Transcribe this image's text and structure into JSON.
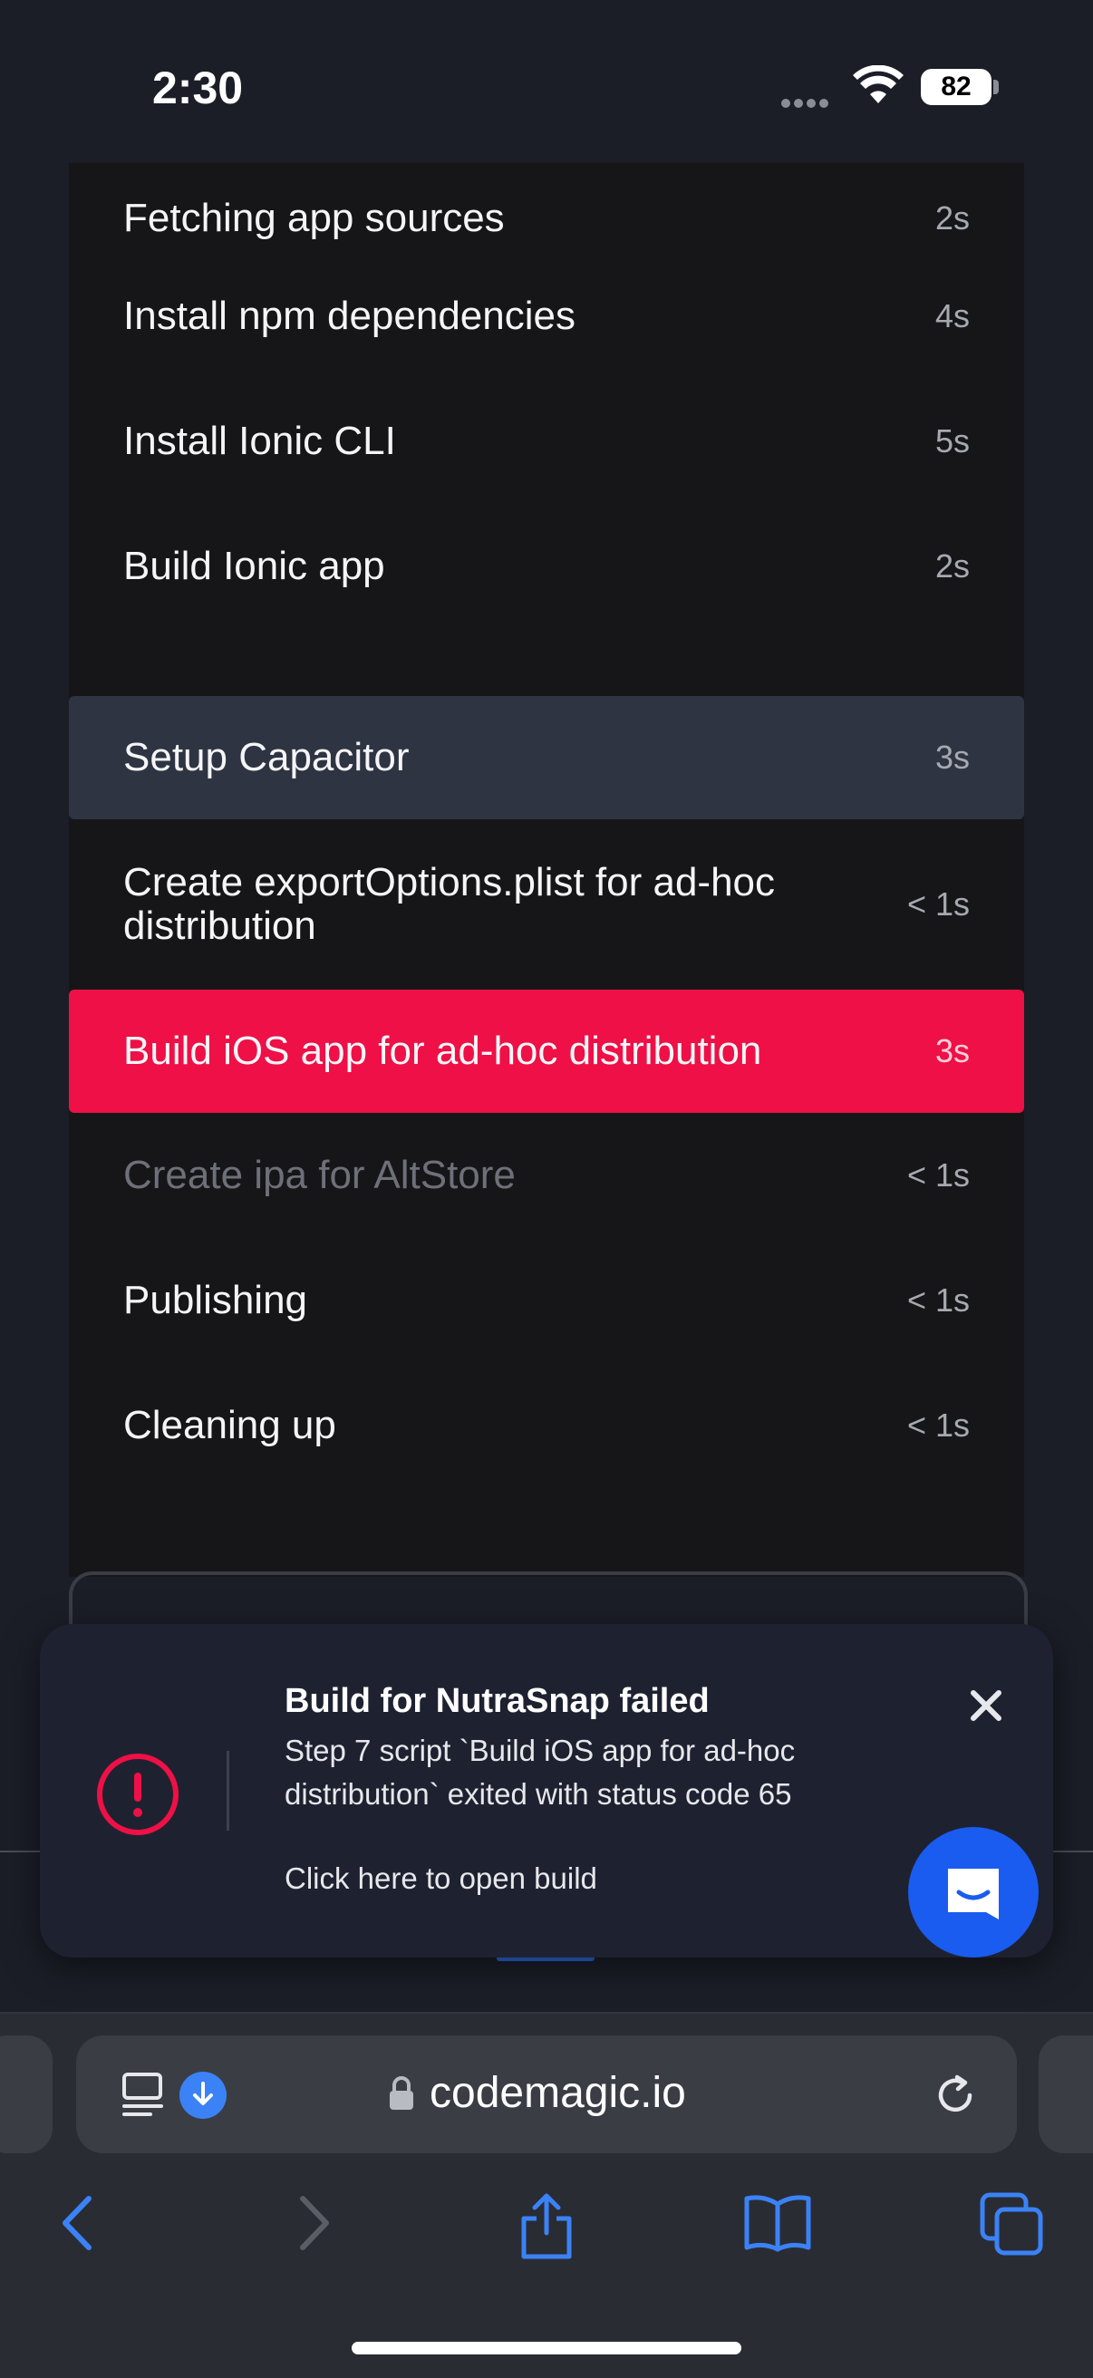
{
  "status_bar": {
    "time": "2:30",
    "battery_level": "82"
  },
  "build_steps": [
    {
      "name": "Fetching app sources",
      "duration": "2s",
      "state": "done"
    },
    {
      "name": "Install npm dependencies",
      "duration": "4s",
      "state": "done"
    },
    {
      "name": "Install Ionic CLI",
      "duration": "5s",
      "state": "done"
    },
    {
      "name": "Build Ionic app",
      "duration": "2s",
      "state": "done"
    },
    {
      "name": "Setup Capacitor",
      "duration": "3s",
      "state": "highlighted"
    },
    {
      "name": "Create exportOptions.plist for ad-hoc distribution",
      "duration": "< 1s",
      "state": "done"
    },
    {
      "name": "Build iOS app for ad-hoc distribution",
      "duration": "3s",
      "state": "failed"
    },
    {
      "name": "Create ipa for AltStore",
      "duration": "< 1s",
      "state": "skipped"
    },
    {
      "name": "Publishing",
      "duration": "< 1s",
      "state": "done"
    },
    {
      "name": "Cleaning up",
      "duration": "< 1s",
      "state": "done"
    }
  ],
  "toast": {
    "title": "Build for NutraSnap failed",
    "message": "Step 7 script `Build iOS app for ad-hoc distribution` exited with status code 65",
    "link_text": "Click here to open build",
    "icon": "alert-circle-icon",
    "accent_color": "#ee1046"
  },
  "browser": {
    "url": "codemagic.io",
    "toolbar_icons": [
      "back-icon",
      "forward-icon",
      "share-icon",
      "bookmarks-icon",
      "tabs-icon"
    ]
  },
  "colors": {
    "failed_row": "#ee1046",
    "highlight_row": "#2e3442",
    "link_blue": "#3b82f6",
    "chat_button": "#1a5cf0"
  }
}
